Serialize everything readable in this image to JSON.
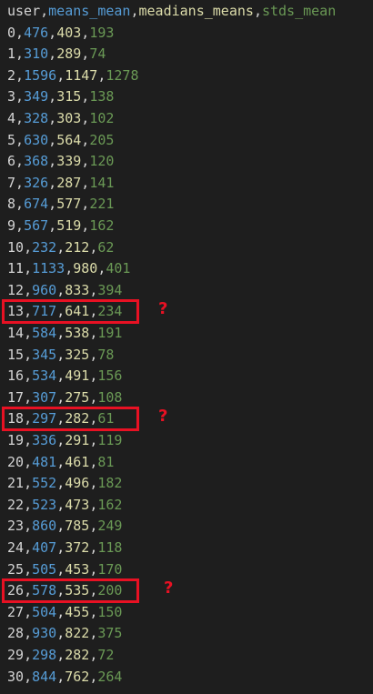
{
  "header": [
    "user",
    "means_mean",
    "meadians_means",
    "stds_mean"
  ],
  "rows": [
    [
      "0",
      "476",
      "403",
      "193"
    ],
    [
      "1",
      "310",
      "289",
      "74"
    ],
    [
      "2",
      "1596",
      "1147",
      "1278"
    ],
    [
      "3",
      "349",
      "315",
      "138"
    ],
    [
      "4",
      "328",
      "303",
      "102"
    ],
    [
      "5",
      "630",
      "564",
      "205"
    ],
    [
      "6",
      "368",
      "339",
      "120"
    ],
    [
      "7",
      "326",
      "287",
      "141"
    ],
    [
      "8",
      "674",
      "577",
      "221"
    ],
    [
      "9",
      "567",
      "519",
      "162"
    ],
    [
      "10",
      "232",
      "212",
      "62"
    ],
    [
      "11",
      "1133",
      "980",
      "401"
    ],
    [
      "12",
      "960",
      "833",
      "394"
    ],
    [
      "13",
      "717",
      "641",
      "234"
    ],
    [
      "14",
      "584",
      "538",
      "191"
    ],
    [
      "15",
      "345",
      "325",
      "78"
    ],
    [
      "16",
      "534",
      "491",
      "156"
    ],
    [
      "17",
      "307",
      "275",
      "108"
    ],
    [
      "18",
      "297",
      "282",
      "61"
    ],
    [
      "19",
      "336",
      "291",
      "119"
    ],
    [
      "20",
      "481",
      "461",
      "81"
    ],
    [
      "21",
      "552",
      "496",
      "182"
    ],
    [
      "22",
      "523",
      "473",
      "162"
    ],
    [
      "23",
      "860",
      "785",
      "249"
    ],
    [
      "24",
      "407",
      "372",
      "118"
    ],
    [
      "25",
      "505",
      "453",
      "170"
    ],
    [
      "26",
      "578",
      "535",
      "200"
    ],
    [
      "27",
      "504",
      "455",
      "150"
    ],
    [
      "28",
      "930",
      "822",
      "375"
    ],
    [
      "29",
      "298",
      "282",
      "72"
    ],
    [
      "30",
      "844",
      "762",
      "264"
    ]
  ],
  "annotations": {
    "highlighted_rows": [
      13,
      18,
      26
    ],
    "mark": "?",
    "color": "#e81123"
  },
  "colors": {
    "background": "#1e1e1e",
    "col0": "#d4d4d4",
    "col1": "#569cd6",
    "col2": "#dcdcaa",
    "col3": "#6a9955"
  }
}
